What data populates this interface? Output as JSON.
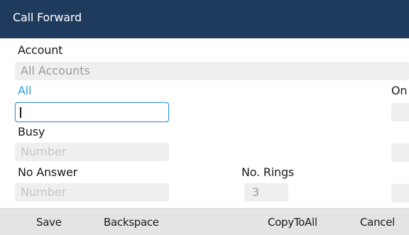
{
  "header": {
    "title": "Call Forward"
  },
  "account": {
    "label": "Account",
    "value": "All Accounts"
  },
  "all": {
    "label": "All",
    "value": "",
    "state_label": "On"
  },
  "busy": {
    "label": "Busy",
    "placeholder": "Number"
  },
  "no_answer": {
    "label": "No Answer",
    "placeholder": "Number",
    "rings_label": "No. Rings",
    "rings_value": "3"
  },
  "softkeys": {
    "save": "Save",
    "backspace": "Backspace",
    "copy_to_all": "CopyToAll",
    "cancel": "Cancel"
  },
  "colors": {
    "title_bar": "#1e3a5c",
    "accent": "#2f9ce0",
    "field_bg": "#efefef",
    "softkey_bar": "#e4e4e4"
  }
}
